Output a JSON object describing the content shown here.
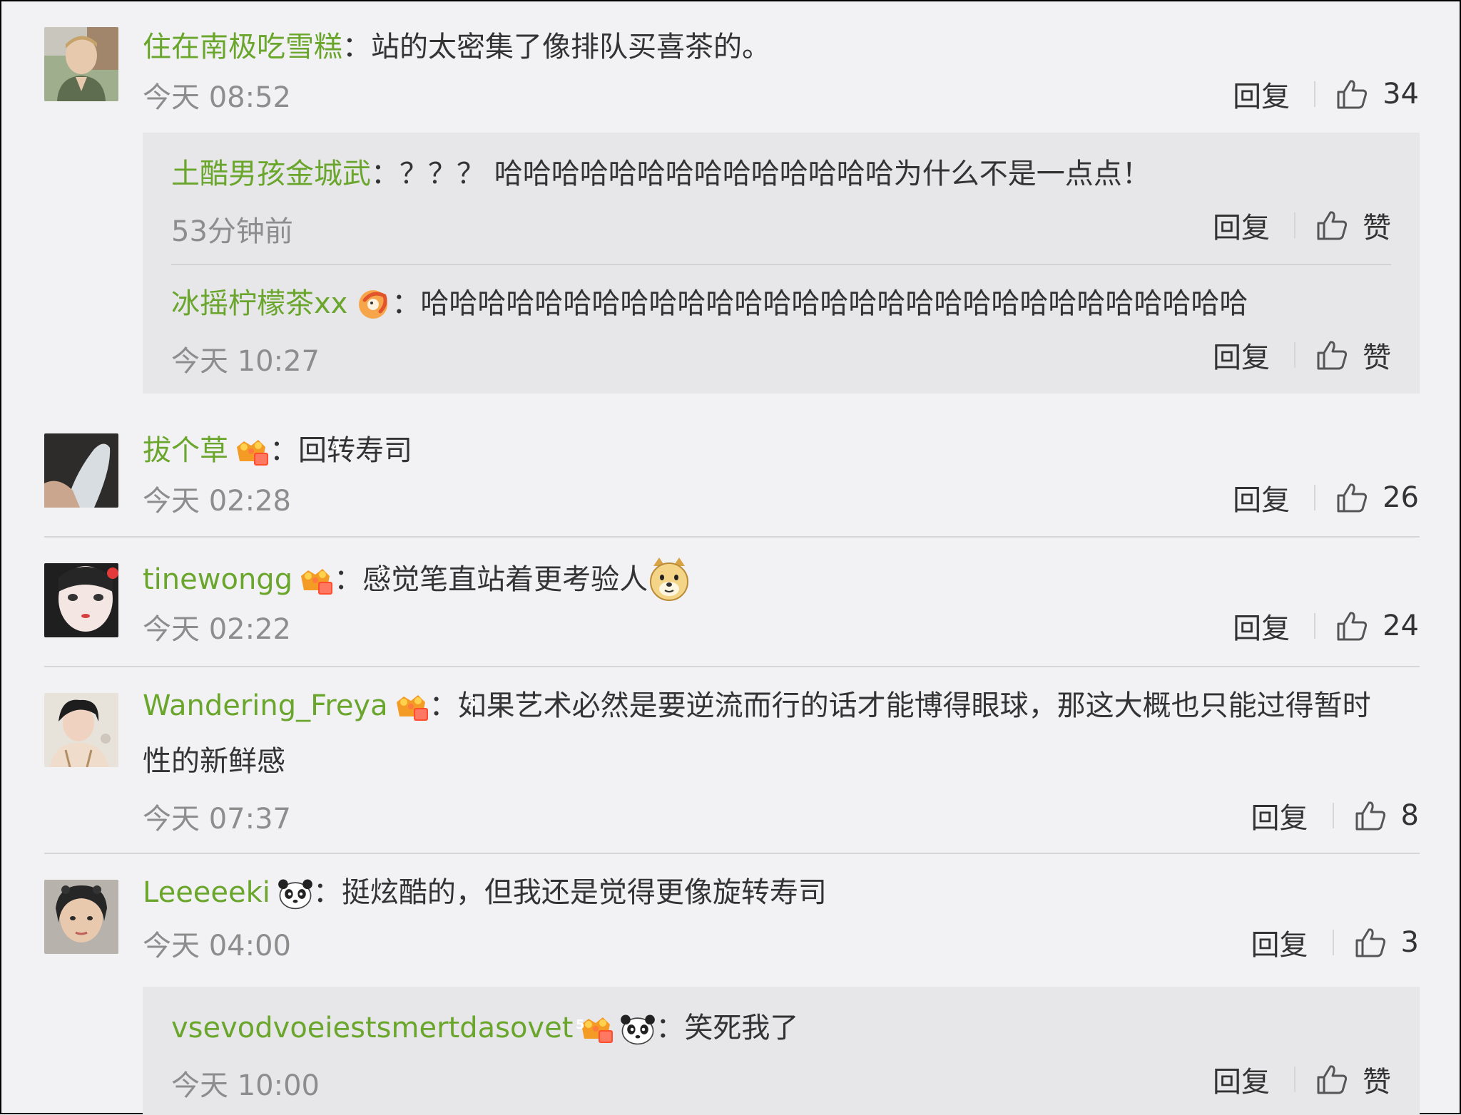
{
  "comments": [
    {
      "username": "住在南极吃雪糕",
      "text": "站的太密集了像排队买喜茶的。",
      "time": "今天 08:52",
      "reply_label": "回复",
      "likes": "34",
      "replies": [
        {
          "username": "土酷男孩金城武",
          "text": "？？？ 哈哈哈哈哈哈哈哈哈哈哈哈哈哈为什么不是一点点！",
          "time": "53分钟前",
          "reply_label": "回复",
          "likes": "赞"
        },
        {
          "username": "冰摇柠檬茶xx",
          "text": "哈哈哈哈哈哈哈哈哈哈哈哈哈哈哈哈哈哈哈哈哈哈哈哈哈哈哈哈哈",
          "time": "今天 10:27",
          "reply_label": "回复",
          "likes": "赞"
        }
      ]
    },
    {
      "username": "拔个草",
      "text": "回转寿司",
      "time": "今天 02:28",
      "reply_label": "回复",
      "likes": "26"
    },
    {
      "username": "tinewongg",
      "text": "感觉笔直站着更考验人",
      "time": "今天 02:22",
      "reply_label": "回复",
      "likes": "24"
    },
    {
      "username": "Wandering_Freya",
      "text": "如果艺术必然是要逆流而行的话才能博得眼球，那这大概也只能过得暂时",
      "text_line2": "性的新鲜感",
      "time": "今天 07:37",
      "reply_label": "回复",
      "likes": "8"
    },
    {
      "username": "Leeeeeki",
      "text": "挺炫酷的，但我还是觉得更像旋转寿司",
      "time": "今天 04:00",
      "reply_label": "回复",
      "likes": "3",
      "replies": [
        {
          "username": "vsevodvoeiestsmertdasovet",
          "text": "笑死我了",
          "time": "今天 10:00",
          "reply_label": "回复",
          "likes": "赞"
        }
      ]
    }
  ],
  "colon": "：",
  "badges": {
    "c2": "4",
    "c3": "6",
    "c4": "5",
    "r3": "5"
  },
  "colors": {
    "username": "#6aa52c",
    "time": "#8d8d8d",
    "background": "#f2f2f5",
    "reply_box": "#e7e7ea"
  },
  "icons": [
    "thumbs-up-icon",
    "vip-crown-badge",
    "panda-emoji",
    "doge-emoji",
    "orange-character-icon"
  ]
}
